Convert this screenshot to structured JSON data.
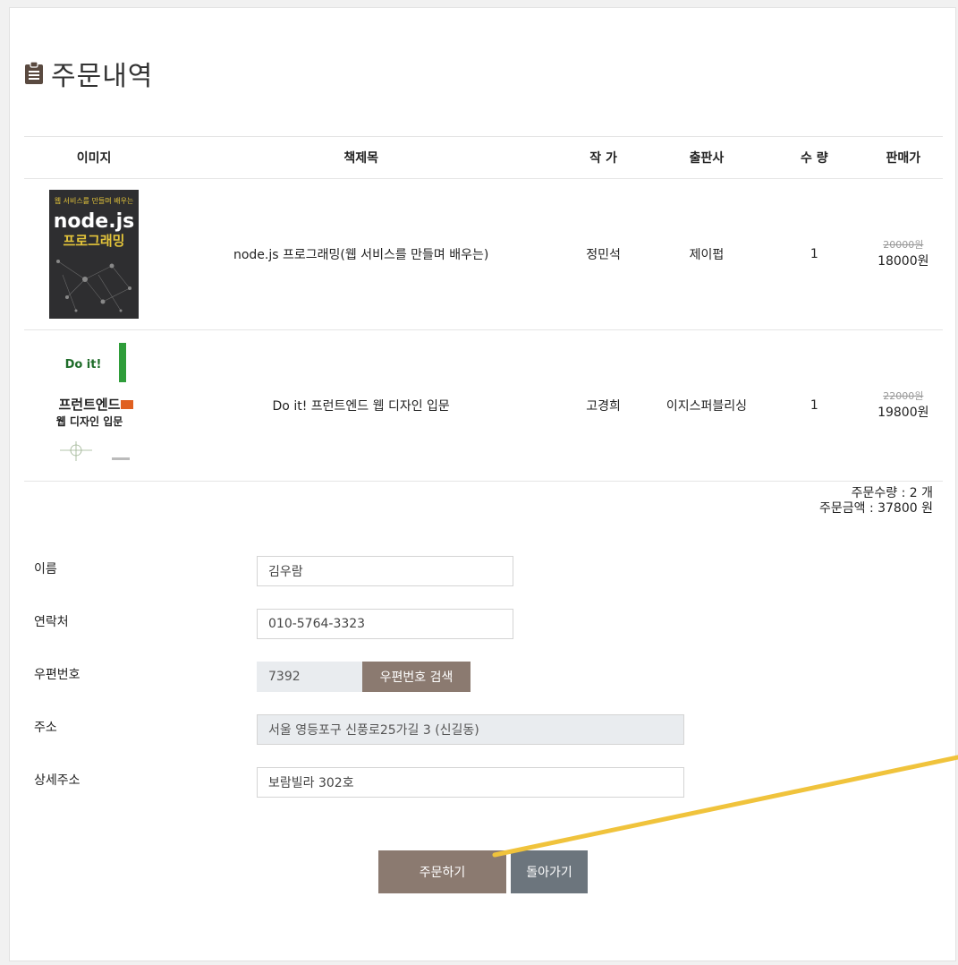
{
  "page": {
    "title": "주문내역"
  },
  "table": {
    "headers": {
      "image": "이미지",
      "title": "책제목",
      "author": "작 가",
      "publisher": "출판사",
      "quantity": "수 량",
      "price": "판매가"
    },
    "rows": [
      {
        "cover_text_top": "웹 서비스를 만들며 배우는",
        "cover_text_main": "node.js",
        "cover_text_sub": "프로그래밍",
        "title": "node.js 프로그래밍(웹 서비스를 만들며 배우는)",
        "author": "정민석",
        "publisher": "제이펍",
        "quantity": "1",
        "original_price": "20000원",
        "sale_price": "18000원"
      },
      {
        "cover_text_top": "Do it!",
        "cover_text_main": "프런트엔드",
        "cover_text_sub": "웹 디자인 입문",
        "title": "Do it! 프런트엔드 웹 디자인 입문",
        "author": "고경희",
        "publisher": "이지스퍼블리싱",
        "quantity": "1",
        "original_price": "22000원",
        "sale_price": "19800원"
      }
    ]
  },
  "summary": {
    "count_line": "주문수량 : 2 개",
    "amount_line": "주문금액 : 37800 원"
  },
  "form": {
    "name_label": "이름",
    "name_value": "김우람",
    "phone_label": "연락처",
    "phone_value": "010-5764-3323",
    "zip_label": "우편번호",
    "zip_value": "7392",
    "zip_button": "우편번호 검색",
    "address_label": "주소",
    "address_value": "서울 영등포구 신풍로25가길 3 (신길동)",
    "detail_label": "상세주소",
    "detail_value": "보람빌라 302호"
  },
  "actions": {
    "order_button": "주문하기",
    "back_button": "돌아가기"
  },
  "colors": {
    "accent_brown": "#8b7a70",
    "secondary_gray": "#6c757d",
    "annotation_yellow": "#f0c33c"
  }
}
